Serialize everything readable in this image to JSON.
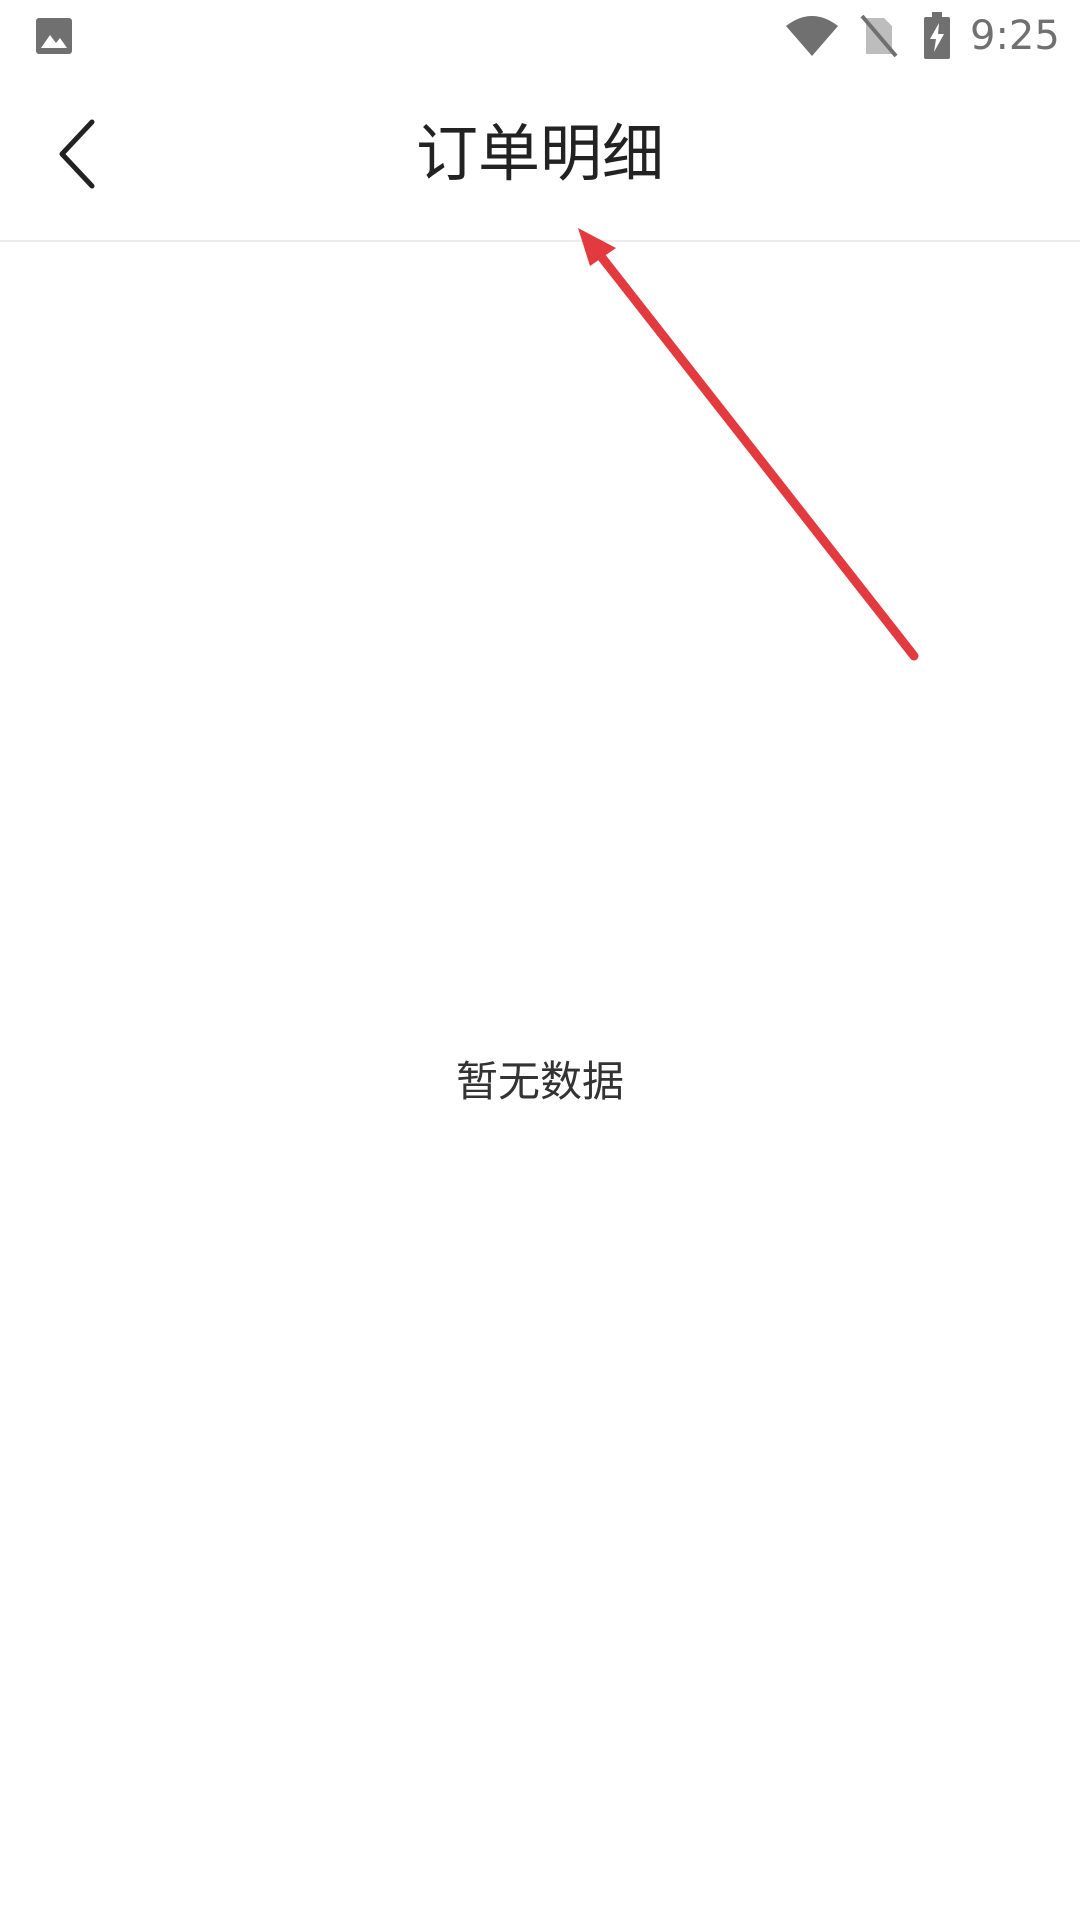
{
  "status_bar": {
    "time": "9:25",
    "icons": [
      "gallery-icon",
      "wifi-icon",
      "sim-card-off-icon",
      "battery-charging-icon"
    ],
    "icon_color": "#707070"
  },
  "nav": {
    "title": "订单明细",
    "back_icon": "chevron-left-icon"
  },
  "content": {
    "empty_message": "暂无数据"
  },
  "annotation": {
    "type": "arrow",
    "color": "#e23a3e"
  }
}
